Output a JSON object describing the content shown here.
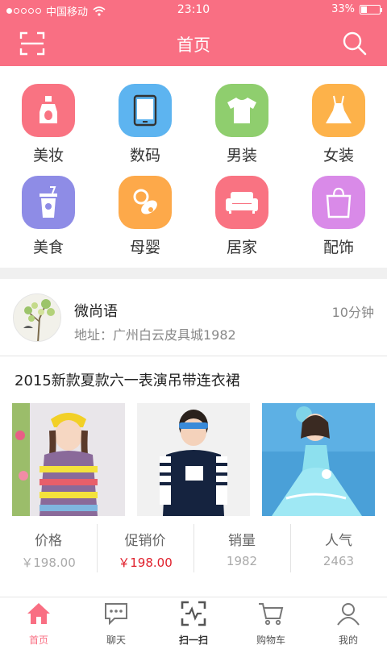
{
  "status_bar": {
    "carrier": "中国移动",
    "time": "23:10",
    "battery": "33%",
    "battery_level": 0.33
  },
  "header": {
    "title": "首页"
  },
  "categories": [
    {
      "label": "美妆",
      "icon": "perfume-icon",
      "color": "#f97382"
    },
    {
      "label": "数码",
      "icon": "tablet-icon",
      "color": "#5db4f0"
    },
    {
      "label": "男装",
      "icon": "tshirt-icon",
      "color": "#8fce6e"
    },
    {
      "label": "女装",
      "icon": "dress-icon",
      "color": "#fdb24a"
    },
    {
      "label": "美食",
      "icon": "drink-icon",
      "color": "#8e8ce6"
    },
    {
      "label": "母婴",
      "icon": "pacifier-icon",
      "color": "#fda94a"
    },
    {
      "label": "居家",
      "icon": "sofa-icon",
      "color": "#f97382"
    },
    {
      "label": "配饰",
      "icon": "bag-icon",
      "color": "#d98ae8"
    }
  ],
  "shop": {
    "name": "微尚语",
    "time": "10分钟",
    "address": "地址：广州白云皮具城1982"
  },
  "product": {
    "title": "2015新款夏款六一表演吊带连衣裙",
    "stats": [
      {
        "key": "价格",
        "value": "￥198.00"
      },
      {
        "key": "促销价",
        "value": "￥198.00"
      },
      {
        "key": "销量",
        "value": "1982"
      },
      {
        "key": "人气",
        "value": "2463"
      }
    ]
  },
  "tabs": [
    {
      "label": "首页",
      "icon": "home-icon"
    },
    {
      "label": "聊天",
      "icon": "chat-icon"
    },
    {
      "label": "扫一扫",
      "icon": "scan-icon"
    },
    {
      "label": "购物车",
      "icon": "cart-icon"
    },
    {
      "label": "我的",
      "icon": "user-icon"
    }
  ],
  "colors": {
    "brand": "#f96f83",
    "promo_price": "#e0202c"
  }
}
